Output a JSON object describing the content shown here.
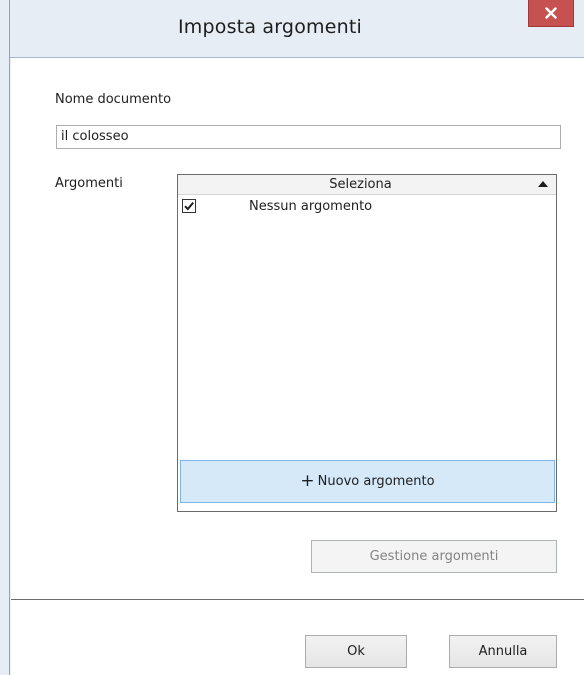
{
  "window": {
    "title": "Imposta argomenti"
  },
  "form": {
    "document_name_label": "Nome documento",
    "document_name_value": "il colosseo",
    "topics_label": "Argomenti"
  },
  "topics_grid": {
    "column_header": "Seleziona",
    "sort_direction": "ascending",
    "rows": [
      {
        "checked": true,
        "label": "Nessun argomento"
      }
    ],
    "new_topic_label": "Nuovo argomento"
  },
  "buttons": {
    "manage_topics": "Gestione argomenti",
    "ok": "Ok",
    "cancel": "Annulla"
  },
  "icons": {
    "close": "close-icon",
    "plus": "plus-icon",
    "check": "check-icon",
    "sort": "sort-ascending-icon"
  },
  "colors": {
    "close_button": "#c75050",
    "new_topic_background": "#d6e9f8",
    "new_topic_border": "#7eb4ea"
  }
}
